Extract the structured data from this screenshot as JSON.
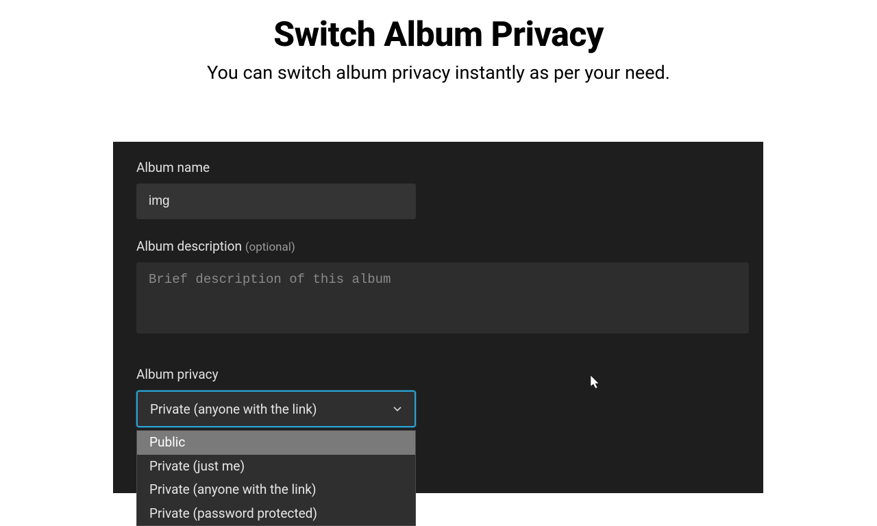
{
  "header": {
    "title": "Switch Album Privacy",
    "subtitle": "You can switch album privacy instantly as per your need."
  },
  "form": {
    "album_name": {
      "label": "Album name",
      "value": "img"
    },
    "album_description": {
      "label": "Album description",
      "optional_text": "(optional)",
      "placeholder": "Brief description of this album",
      "value": ""
    },
    "album_privacy": {
      "label": "Album privacy",
      "selected": "Private (anyone with the link)",
      "options": [
        "Public",
        "Private (just me)",
        "Private (anyone with the link)",
        "Private (password protected)"
      ],
      "highlighted_index": 0
    }
  }
}
